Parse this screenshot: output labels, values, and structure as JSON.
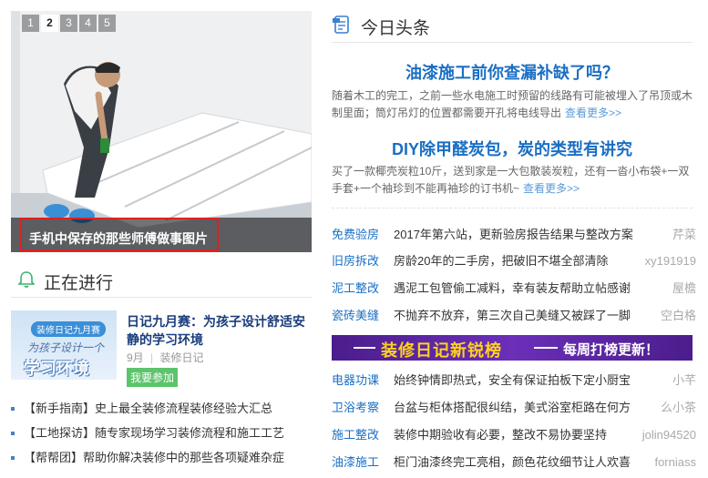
{
  "slider": {
    "pages": [
      "1",
      "2",
      "3",
      "4",
      "5"
    ],
    "active_page": "2",
    "caption": "手机中保存的那些师傅做事图片"
  },
  "ongoing": {
    "title": "正在进行",
    "item": {
      "image_tag": "装修日记九月赛",
      "image_line1": "为孩子设计一个",
      "image_line2": "学习环境",
      "title": "日记九月赛：为孩子设计舒适安静的学习环境",
      "month": "9月",
      "source": "装修日记",
      "join": "我要参加"
    },
    "links": [
      "【新手指南】史上最全装修流程装修经验大汇总",
      "【工地探访】随专家现场学习装修流程和施工工艺",
      "【帮帮团】帮助你解决装修中的那些各项疑难杂症"
    ]
  },
  "headlines_section": {
    "title": "今日头条",
    "items": [
      {
        "title": "油漆施工前你查漏补缺了吗？",
        "desc": "随着木工的完工，之前一些水电施工时预留的线路有可能被埋入了吊顶或木制里面；筒灯吊灯的位置都需要开孔将电线导出",
        "more": "查看更多>>"
      },
      {
        "title": "DIY除甲醛炭包，炭的类型有讲究",
        "desc": "买了一款椰壳炭粒10斤，送到家是一大包散装炭粒，还有一沓小布袋+一双手套+一个袖珍到不能再袖珍的订书机~",
        "more": "查看更多>>"
      }
    ]
  },
  "news_top": [
    {
      "cat": "免费验房",
      "title": "2017年第六站，更新验房报告结果与整改方案",
      "user": "芹菜"
    },
    {
      "cat": "旧房拆改",
      "title": "房龄20年的二手房，把破旧不堪全部清除",
      "user": "xy191919"
    },
    {
      "cat": "泥工整改",
      "title": "遇泥工包管偷工减料，幸有装友帮助立帖感谢",
      "user": "屋檐"
    },
    {
      "cat": "瓷砖美缝",
      "title": "不抛弃不放弃，第三次自己美缝又被踩了一脚",
      "user": "空白格"
    }
  ],
  "banner": {
    "main": "装修日记新锐榜",
    "sub": "每周打榜更新！"
  },
  "news_bottom": [
    {
      "cat": "电器功课",
      "title": "始终钟情即热式，安全有保证拍板下定小厨宝",
      "user": "小芊"
    },
    {
      "cat": "卫浴考察",
      "title": "台盆与柜体搭配很纠结，美式浴室柜路在何方",
      "user": "么小茶"
    },
    {
      "cat": "施工整改",
      "title": "装修中期验收有必要，整改不易协要坚持",
      "user": "jolin94520"
    },
    {
      "cat": "油漆施工",
      "title": "柜门油漆终完工亮相，颜色花纹细节让人欢喜",
      "user": "forniass"
    }
  ],
  "colors": {
    "link_blue": "#1a6fc4",
    "join_green": "#5cc46a",
    "banner_purple": "#5a26a6",
    "banner_yellow": "#ffd21f",
    "highlight_red": "#e02020"
  }
}
